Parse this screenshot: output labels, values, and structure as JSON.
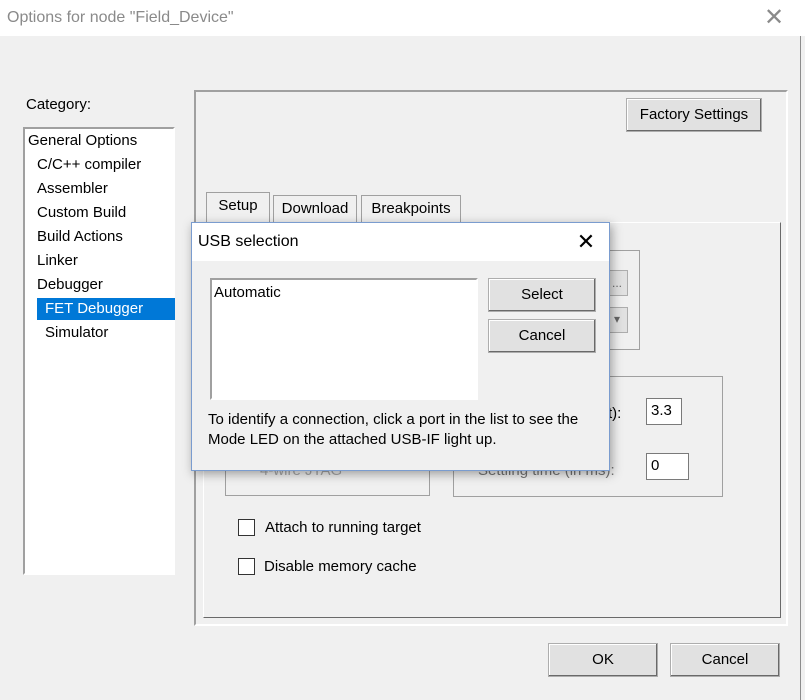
{
  "window": {
    "title": "Options for node \"Field_Device\"",
    "close_glyph": "✕"
  },
  "category": {
    "label": "Category:",
    "items": [
      {
        "label": "General Options"
      },
      {
        "label": "C/C++ compiler"
      },
      {
        "label": "Assembler"
      },
      {
        "label": "Custom Build"
      },
      {
        "label": "Build Actions"
      },
      {
        "label": "Linker"
      },
      {
        "label": "Debugger"
      },
      {
        "label": "FET Debugger"
      },
      {
        "label": "Simulator"
      }
    ],
    "selected": "FET Debugger"
  },
  "panel": {
    "factory_settings": "Factory Settings",
    "tabs": [
      {
        "label": "Setup"
      },
      {
        "label": "Download"
      },
      {
        "label": "Breakpoints"
      }
    ],
    "active_tab": "Setup",
    "partial_browse": "...",
    "voltage_label_fragment": "t):",
    "voltage_value": "3.3",
    "settle_label_fragment": "Settling time (in ms):",
    "settle_value": "0",
    "fourwire_fragment": "4-wire JTAG",
    "attach_label": "Attach to running target",
    "disable_cache_label": "Disable memory cache"
  },
  "footer": {
    "ok": "OK",
    "cancel": "Cancel"
  },
  "usb_dialog": {
    "title": "USB selection",
    "close_glyph": "✕",
    "list_items": [
      "Automatic"
    ],
    "select": "Select",
    "cancel": "Cancel",
    "hint": "To identify a connection, click a port in the list to see the Mode LED on the attached USB-IF light up."
  },
  "colors": {
    "selection": "#0078d7",
    "dialog_bg": "#f0f0f0"
  }
}
